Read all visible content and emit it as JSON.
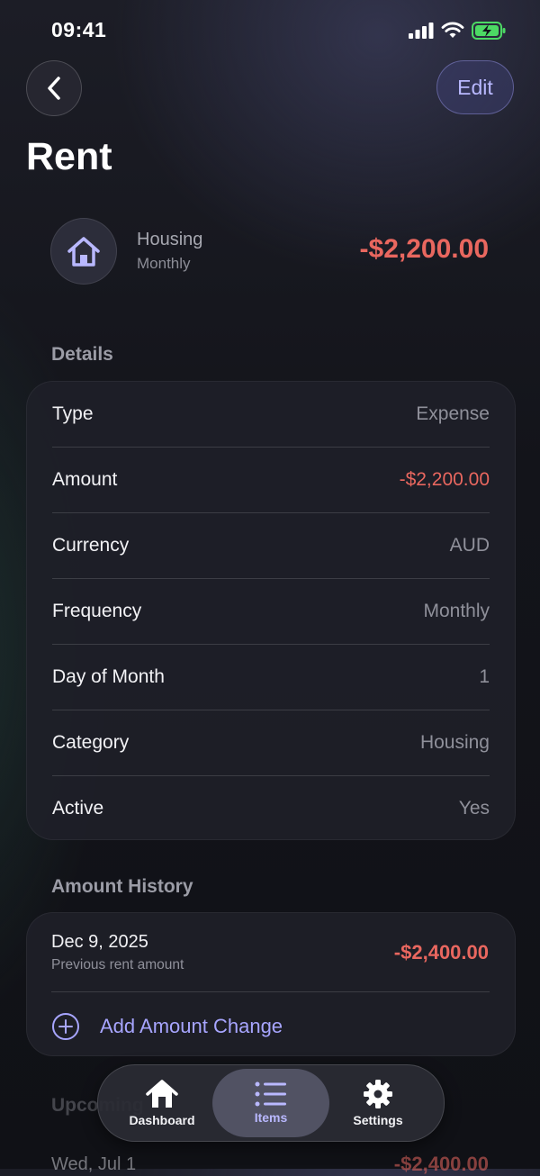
{
  "status": {
    "time": "09:41"
  },
  "nav": {
    "edit_label": "Edit"
  },
  "title": "Rent",
  "summary": {
    "icon": "house-icon",
    "category": "Housing",
    "frequency": "Monthly",
    "amount": "-$2,200.00"
  },
  "details": {
    "title": "Details",
    "rows": [
      {
        "label": "Type",
        "value": "Expense"
      },
      {
        "label": "Amount",
        "value": "-$2,200.00"
      },
      {
        "label": "Currency",
        "value": "AUD"
      },
      {
        "label": "Frequency",
        "value": "Monthly"
      },
      {
        "label": "Day of Month",
        "value": "1"
      },
      {
        "label": "Category",
        "value": "Housing"
      },
      {
        "label": "Active",
        "value": "Yes"
      }
    ]
  },
  "history": {
    "title": "Amount History",
    "entries": [
      {
        "date": "Dec 9, 2025",
        "note": "Previous rent amount",
        "amount": "-$2,400.00"
      }
    ],
    "add_label": "Add Amount Change"
  },
  "upcoming": {
    "title": "Upcoming",
    "first_date": "Wed, Jul 1",
    "first_amount": "-$2,400.00"
  },
  "tabs": [
    {
      "label": "Dashboard",
      "icon": "house-icon"
    },
    {
      "label": "Items",
      "icon": "list-icon",
      "active": true
    },
    {
      "label": "Settings",
      "icon": "gear-icon"
    }
  ],
  "colors": {
    "negative": "#e9675f",
    "accent": "#b9b8ff",
    "battery": "#4cd964"
  }
}
